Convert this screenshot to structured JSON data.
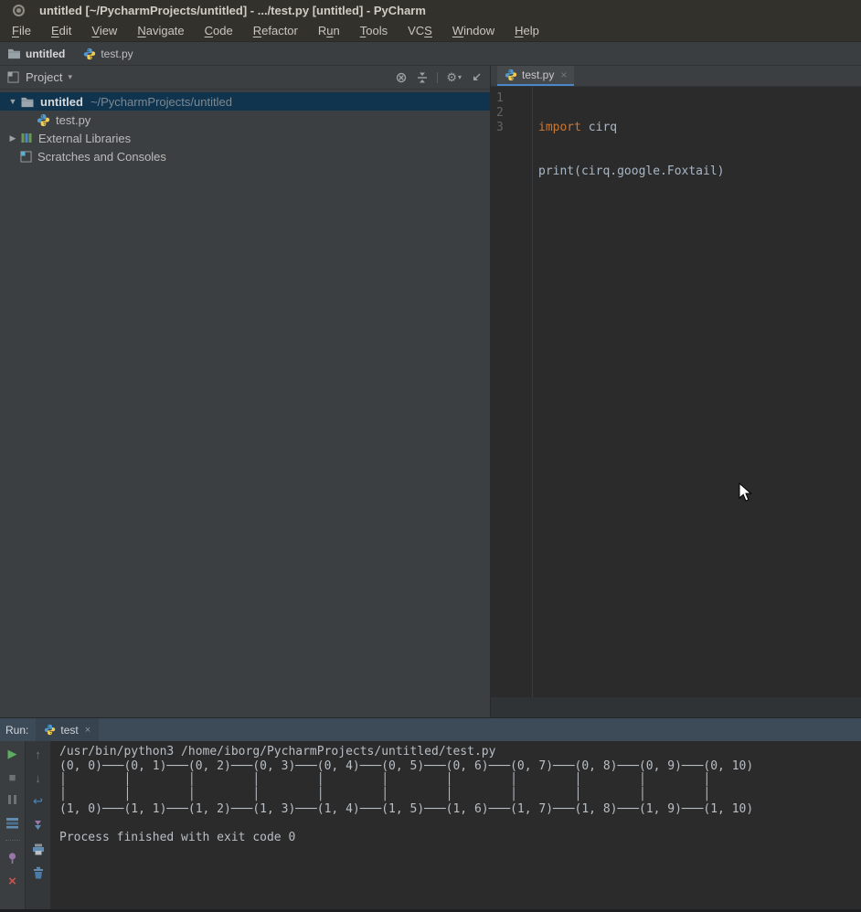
{
  "window": {
    "title": "untitled [~/PycharmProjects/untitled] - .../test.py [untitled] - PyCharm"
  },
  "menubar": {
    "items": [
      {
        "label": "File",
        "m": 0
      },
      {
        "label": "Edit",
        "m": 0
      },
      {
        "label": "View",
        "m": 0
      },
      {
        "label": "Navigate",
        "m": 0
      },
      {
        "label": "Code",
        "m": 0
      },
      {
        "label": "Refactor",
        "m": 0
      },
      {
        "label": "Run",
        "m": 1
      },
      {
        "label": "Tools",
        "m": 0
      },
      {
        "label": "VCS",
        "m": 2
      },
      {
        "label": "Window",
        "m": 0
      },
      {
        "label": "Help",
        "m": 0
      }
    ]
  },
  "breadcrumbs": {
    "project": "untitled",
    "file": "test.py"
  },
  "project_panel": {
    "header": {
      "title": "Project",
      "caret": "▾"
    },
    "tree": [
      {
        "label": "untitled",
        "path": "~/PycharmProjects/untitled",
        "expanded": "▼"
      },
      {
        "label": "test.py"
      },
      {
        "label": "External Libraries",
        "collapsed": "▶"
      },
      {
        "label": "Scratches and Consoles"
      }
    ]
  },
  "editor": {
    "tab": "test.py",
    "tab_close": "×",
    "gutter": [
      "1",
      "2",
      "3"
    ],
    "code": {
      "line1_keyword": "import",
      "line1_rest": " cirq",
      "line2": "print(cirq.google.Foxtail)"
    }
  },
  "run_panel": {
    "label": "Run:",
    "tab": "test",
    "tab_close": "×",
    "toolbar": {
      "rerun": "▶",
      "stop": "■",
      "close": "×",
      "up": "↑",
      "down": "↓",
      "soft_wrap": "↩"
    },
    "console_text": "/usr/bin/python3 /home/iborg/PycharmProjects/untitled/test.py\n(0, 0)───(0, 1)───(0, 2)───(0, 3)───(0, 4)───(0, 5)───(0, 6)───(0, 7)───(0, 8)───(0, 9)───(0, 10)\n│        │        │        │        │        │        │        │        │        │        │\n│        │        │        │        │        │        │        │        │        │        │\n(1, 0)───(1, 1)───(1, 2)───(1, 3)───(1, 4)───(1, 5)───(1, 6)───(1, 7)───(1, 8)───(1, 9)───(1, 10)\n\nProcess finished with exit code 0"
  },
  "colors": {
    "editor_bg": "#2b2b2b",
    "panel_bg": "#3c3f41",
    "titlebar_bg": "#33312c",
    "selection_bg": "#10344e",
    "tab_underline": "#4a88c7",
    "run_header_bg": "#3d4a57",
    "keyword": "#cc7832",
    "code_text": "#a9b7c6",
    "run_green": "#5cad60",
    "close_red": "#c75450",
    "pin_purple": "#9876aa",
    "icon_blue": "#4a88c7"
  }
}
